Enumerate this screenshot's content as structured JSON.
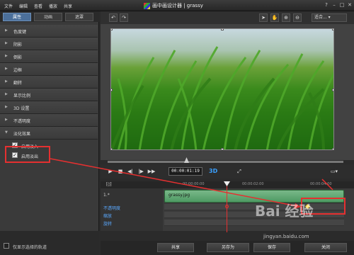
{
  "menu": [
    "文件",
    "编辑",
    "查看",
    "播放",
    "共享"
  ],
  "app_title": "画中画设计器 | grassy",
  "window_controls": [
    "?",
    "–",
    "□",
    "✕"
  ],
  "tabs": [
    "属性",
    "动画",
    "遮罩"
  ],
  "properties": [
    {
      "label": "色度键"
    },
    {
      "label": "阴影"
    },
    {
      "label": "倒影"
    },
    {
      "label": "边框"
    },
    {
      "label": "翻转"
    },
    {
      "label": "显示比例"
    },
    {
      "label": "3D 设置"
    },
    {
      "label": "不透明度"
    },
    {
      "label": "淡化效果"
    }
  ],
  "fade": {
    "fade_in_label": "启用淡入",
    "fade_in_checked": true,
    "fade_out_label": "启用淡出",
    "fade_out_checked": true
  },
  "only_selected_label": "仅显示选择的轨道",
  "zoom_value": "适合...",
  "timecode": "00:00:01:19",
  "badge3d": "3D",
  "timeline": {
    "head_label": "[◊]",
    "track_label": "1.*",
    "clip_name": "grassy.jpg",
    "rows": [
      "不透明度",
      "缩放",
      "旋转"
    ],
    "ruler": [
      "00:00:00:00",
      "00:00:02:00",
      "00:00:04:00"
    ]
  },
  "bottom_buttons": [
    "共享",
    "另存为",
    "保存",
    "关闭"
  ],
  "watermark": "Bai 经验",
  "watermark_sub": "jingyan.baidu.com",
  "colors": {
    "accent": "#4b6f9a",
    "annotation": "#e53030",
    "clip": "#5fa872",
    "keyframe": "#f5d23b"
  }
}
